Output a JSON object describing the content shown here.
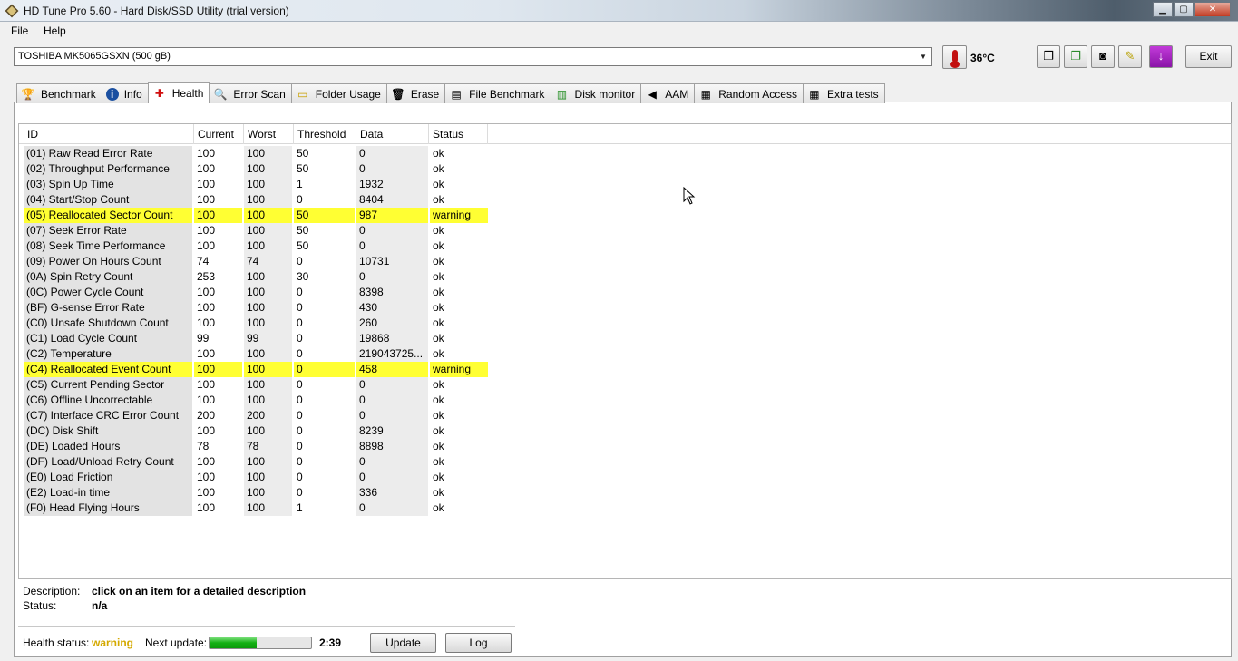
{
  "window": {
    "title": "HD Tune Pro 5.60 - Hard Disk/SSD Utility (trial version)",
    "controls": {
      "minimize": "▁",
      "maximize": "▢",
      "close": "✕"
    }
  },
  "menu": {
    "file": "File",
    "help": "Help"
  },
  "toolbar": {
    "drive": "TOSHIBA MK5065GSXN (500 gB)",
    "temperature": "36°C",
    "exit": "Exit",
    "icons": [
      "copy-text-icon",
      "copy-screenshot-icon",
      "camera-icon",
      "options-icon",
      "save-down-icon"
    ]
  },
  "tabs": [
    {
      "label": "Benchmark",
      "icon": "benchmark-icon",
      "glyph": "🏆",
      "active": false
    },
    {
      "label": "Info",
      "icon": "info-icon",
      "glyph": "i",
      "active": false
    },
    {
      "label": "Health",
      "icon": "health-icon",
      "glyph": "✚",
      "active": true
    },
    {
      "label": "Error Scan",
      "icon": "error-scan-icon",
      "glyph": "🔍",
      "active": false
    },
    {
      "label": "Folder Usage",
      "icon": "folder-usage-icon",
      "glyph": "▭",
      "active": false
    },
    {
      "label": "Erase",
      "icon": "erase-icon",
      "glyph": "🗑",
      "active": false
    },
    {
      "label": "File Benchmark",
      "icon": "file-benchmark-icon",
      "glyph": "▤",
      "active": false
    },
    {
      "label": "Disk monitor",
      "icon": "disk-monitor-icon",
      "glyph": "▥",
      "active": false
    },
    {
      "label": "AAM",
      "icon": "aam-speaker-icon",
      "glyph": "◀",
      "active": false
    },
    {
      "label": "Random Access",
      "icon": "random-access-icon",
      "glyph": "▦",
      "active": false
    },
    {
      "label": "Extra tests",
      "icon": "extra-tests-icon",
      "glyph": "▦",
      "active": false
    }
  ],
  "table": {
    "headers": {
      "id": "ID",
      "current": "Current",
      "worst": "Worst",
      "threshold": "Threshold",
      "data": "Data",
      "status": "Status"
    },
    "rows": [
      {
        "id": "(01) Raw Read Error Rate",
        "current": "100",
        "worst": "100",
        "threshold": "50",
        "data": "0",
        "status": "ok"
      },
      {
        "id": "(02) Throughput Performance",
        "current": "100",
        "worst": "100",
        "threshold": "50",
        "data": "0",
        "status": "ok"
      },
      {
        "id": "(03) Spin Up Time",
        "current": "100",
        "worst": "100",
        "threshold": "1",
        "data": "1932",
        "status": "ok"
      },
      {
        "id": "(04) Start/Stop Count",
        "current": "100",
        "worst": "100",
        "threshold": "0",
        "data": "8404",
        "status": "ok"
      },
      {
        "id": "(05) Reallocated Sector Count",
        "current": "100",
        "worst": "100",
        "threshold": "50",
        "data": "987",
        "status": "warning"
      },
      {
        "id": "(07) Seek Error Rate",
        "current": "100",
        "worst": "100",
        "threshold": "50",
        "data": "0",
        "status": "ok"
      },
      {
        "id": "(08) Seek Time Performance",
        "current": "100",
        "worst": "100",
        "threshold": "50",
        "data": "0",
        "status": "ok"
      },
      {
        "id": "(09) Power On Hours Count",
        "current": "74",
        "worst": "74",
        "threshold": "0",
        "data": "10731",
        "status": "ok"
      },
      {
        "id": "(0A) Spin Retry Count",
        "current": "253",
        "worst": "100",
        "threshold": "30",
        "data": "0",
        "status": "ok"
      },
      {
        "id": "(0C) Power Cycle Count",
        "current": "100",
        "worst": "100",
        "threshold": "0",
        "data": "8398",
        "status": "ok"
      },
      {
        "id": "(BF) G-sense Error Rate",
        "current": "100",
        "worst": "100",
        "threshold": "0",
        "data": "430",
        "status": "ok"
      },
      {
        "id": "(C0) Unsafe Shutdown Count",
        "current": "100",
        "worst": "100",
        "threshold": "0",
        "data": "260",
        "status": "ok"
      },
      {
        "id": "(C1) Load Cycle Count",
        "current": "99",
        "worst": "99",
        "threshold": "0",
        "data": "19868",
        "status": "ok"
      },
      {
        "id": "(C2) Temperature",
        "current": "100",
        "worst": "100",
        "threshold": "0",
        "data": "219043725...",
        "status": "ok"
      },
      {
        "id": "(C4) Reallocated Event Count",
        "current": "100",
        "worst": "100",
        "threshold": "0",
        "data": "458",
        "status": "warning"
      },
      {
        "id": "(C5) Current Pending Sector",
        "current": "100",
        "worst": "100",
        "threshold": "0",
        "data": "0",
        "status": "ok"
      },
      {
        "id": "(C6) Offline Uncorrectable",
        "current": "100",
        "worst": "100",
        "threshold": "0",
        "data": "0",
        "status": "ok"
      },
      {
        "id": "(C7) Interface CRC Error Count",
        "current": "200",
        "worst": "200",
        "threshold": "0",
        "data": "0",
        "status": "ok"
      },
      {
        "id": "(DC) Disk Shift",
        "current": "100",
        "worst": "100",
        "threshold": "0",
        "data": "8239",
        "status": "ok"
      },
      {
        "id": "(DE) Loaded Hours",
        "current": "78",
        "worst": "78",
        "threshold": "0",
        "data": "8898",
        "status": "ok"
      },
      {
        "id": "(DF) Load/Unload Retry Count",
        "current": "100",
        "worst": "100",
        "threshold": "0",
        "data": "0",
        "status": "ok"
      },
      {
        "id": "(E0) Load Friction",
        "current": "100",
        "worst": "100",
        "threshold": "0",
        "data": "0",
        "status": "ok"
      },
      {
        "id": "(E2) Load-in time",
        "current": "100",
        "worst": "100",
        "threshold": "0",
        "data": "336",
        "status": "ok"
      },
      {
        "id": "(F0) Head Flying Hours",
        "current": "100",
        "worst": "100",
        "threshold": "1",
        "data": "0",
        "status": "ok"
      }
    ]
  },
  "details": {
    "description_label": "Description:",
    "description_value": "click on an item for a detailed description",
    "status_label": "Status:",
    "status_value": "n/a"
  },
  "footer": {
    "health_label": "Health status:",
    "health_value": "warning",
    "next_update_label": "Next update:",
    "progress_fraction": 0.46,
    "countdown": "2:39",
    "update_button": "Update",
    "log_button": "Log"
  },
  "colors": {
    "warning_row": "#ffff33",
    "health_warning": "#d4a900",
    "progress": "#14b014"
  }
}
